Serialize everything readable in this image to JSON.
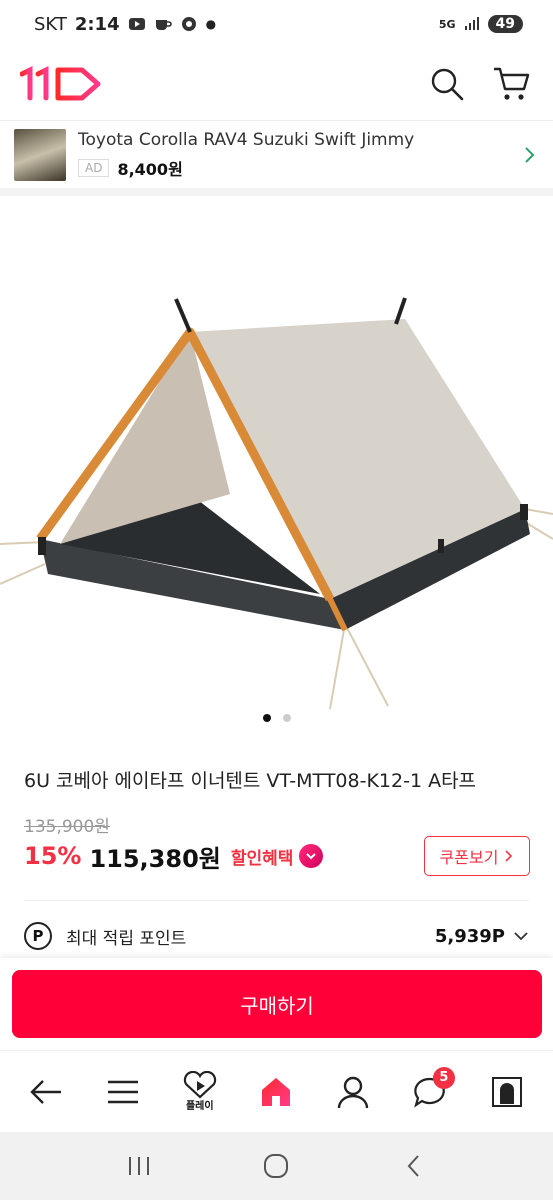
{
  "status_bar": {
    "carrier": "SKT",
    "time": "2:14",
    "network": "5G",
    "battery": "49"
  },
  "header": {
    "logo_text": "11",
    "icons": [
      "search-icon",
      "cart-icon"
    ]
  },
  "ad_banner": {
    "title": "Toyota Corolla RAV4 Suzuki Swift Jimmy",
    "badge": "AD",
    "price": "8,400원"
  },
  "product": {
    "image_dots_total": 2,
    "image_dots_active": 1,
    "title": "6U 코베아 에이타프 이너텐트 VT-MTT08-K12-1 A타프",
    "original_price": "135,900원",
    "discount": "15%",
    "sale_price": "115,380원",
    "benefit_label": "할인혜택",
    "coupon_label": "쿠폰보기",
    "points_label": "최대 적립 포인트",
    "points_value": "5,939P"
  },
  "buy_button": {
    "label": "구매하기"
  },
  "bottom_nav": {
    "play_label": "플레이",
    "chat_badge": "5",
    "items": [
      "back-icon",
      "menu-icon",
      "play-icon",
      "home-icon",
      "account-icon",
      "chat-icon",
      "recent-item-icon"
    ]
  },
  "colors": {
    "accent": "#f43142",
    "buy_button": "#ff0038",
    "brand_gradient_start": "#ff2a2a",
    "brand_gradient_end": "#ff3a8c"
  }
}
